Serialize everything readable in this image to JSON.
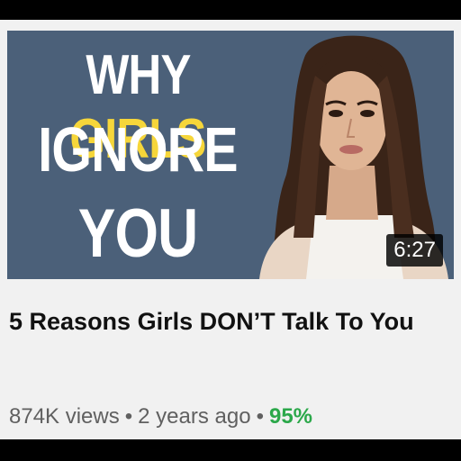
{
  "thumbnail": {
    "line1_a": "WHY",
    "line1_b": "GIRLS",
    "line2": "IGNORE",
    "line3": "YOU",
    "duration": "6:27",
    "colors": {
      "background": "#4b6079",
      "accent": "#f6d63a",
      "text": "#ffffff"
    }
  },
  "video": {
    "title": "5 Reasons Girls DON’T Talk To You",
    "views": "874K views",
    "separator": "•",
    "age": "2 years ago",
    "rating": "95%",
    "rating_color": "#2ba84a"
  }
}
